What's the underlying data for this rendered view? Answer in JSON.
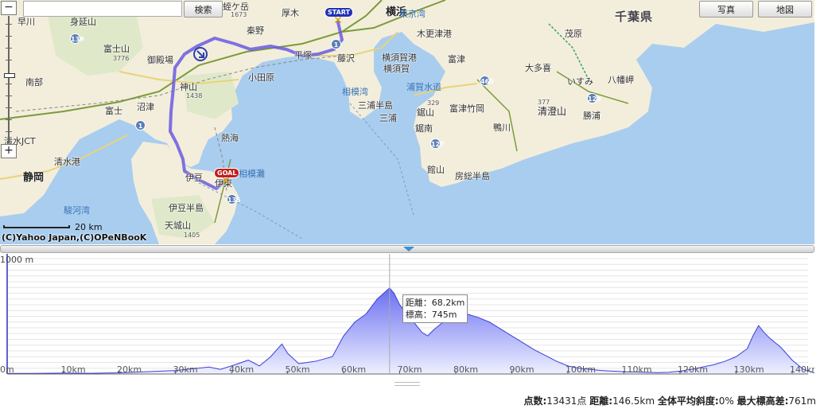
{
  "search": {
    "placeholder": "",
    "value": "",
    "button_label": "検索"
  },
  "map_buttons": {
    "photo": "写真",
    "map": "地図"
  },
  "zoom": {
    "out_label": "−",
    "in_label": "+"
  },
  "scale_label": "20 km",
  "copyright": "(C)Yahoo Japan,(C)OPeNBooK",
  "markers": {
    "start": "START",
    "goal": "GOAL"
  },
  "map_labels": {
    "prefectures": [
      "千葉県"
    ],
    "cities": [
      "横浜",
      "静岡"
    ],
    "places": [
      "蛭ケ岳",
      "厚木",
      "秦野",
      "小田原",
      "御殿場",
      "神山",
      "平塚",
      "藤沢",
      "横須賀港",
      "横須賀",
      "木更津港",
      "富津",
      "大多喜",
      "いすみ",
      "八幡岬",
      "茂原",
      "清澄山",
      "勝浦",
      "鴨川",
      "富津竹岡",
      "鋸山",
      "鋸南",
      "館山",
      "房総半島",
      "三浦半島",
      "三浦",
      "富士山",
      "富士",
      "沼津",
      "熱海",
      "伊豆",
      "伊東",
      "伊豆半島",
      "天城山",
      "清水港",
      "清水JCT",
      "南部",
      "早川",
      "身延山"
    ],
    "water": [
      "東京湾",
      "相模湾",
      "浦賀水道",
      "駿河湾",
      "相模灘"
    ],
    "peaks": [
      "1673",
      "3776",
      "1438",
      "329",
      "377",
      "1405"
    ],
    "routes": [
      "1",
      "139",
      "1",
      "127",
      "128",
      "465",
      "1",
      "135",
      "1"
    ]
  },
  "chart_data": {
    "type": "area",
    "title": "",
    "xlabel": "",
    "ylabel": "",
    "x_unit": "km",
    "y_unit": "m",
    "xlim": [
      0,
      146.5
    ],
    "ylim": [
      0,
      1000
    ],
    "x_ticks": [
      "0m",
      "10km",
      "20km",
      "30km",
      "40km",
      "50km",
      "60km",
      "70km",
      "80km",
      "90km",
      "100km",
      "110km",
      "120km",
      "130km",
      "140km"
    ],
    "y_tick_label": "1000 m",
    "x": [
      0,
      5,
      10,
      15,
      20,
      25,
      30,
      33,
      36,
      38,
      40,
      43,
      45,
      47,
      49,
      50,
      52,
      55,
      58,
      60,
      62,
      64,
      66,
      68.2,
      69,
      70,
      72,
      74,
      75,
      76,
      78,
      80,
      82,
      84,
      86,
      88,
      90,
      92,
      94,
      96,
      98,
      100,
      102,
      104,
      106,
      108,
      110,
      112,
      114,
      116,
      118,
      120,
      122,
      124,
      126,
      128,
      130,
      132,
      133,
      134,
      135,
      136,
      138,
      140,
      142,
      144,
      146.5
    ],
    "values": [
      5,
      5,
      8,
      6,
      10,
      20,
      30,
      45,
      60,
      40,
      70,
      120,
      70,
      150,
      260,
      180,
      90,
      110,
      150,
      330,
      450,
      520,
      650,
      745,
      700,
      600,
      480,
      360,
      330,
      380,
      460,
      510,
      520,
      490,
      450,
      390,
      330,
      270,
      210,
      160,
      110,
      70,
      50,
      40,
      30,
      25,
      20,
      18,
      15,
      12,
      15,
      25,
      40,
      60,
      80,
      110,
      150,
      220,
      330,
      420,
      360,
      310,
      230,
      120,
      40,
      10,
      5
    ],
    "cursor": {
      "distance_label": "距離：68.2km",
      "elevation_label": "標高：745m"
    }
  },
  "stats": {
    "points_label": "点数:",
    "points_value": "13431点",
    "distance_label": "距離:",
    "distance_value": "146.5km",
    "slope_label": "全体平均斜度:",
    "slope_value": "0%",
    "max_diff_label": "最大標高差:",
    "max_diff_value": "761m"
  },
  "colors": {
    "sea": "#a9cdee",
    "land": "#f4efde",
    "route": "#6a5ae0",
    "profile_fill": "#8a8ef0",
    "profile_line": "#3b3fd8"
  }
}
